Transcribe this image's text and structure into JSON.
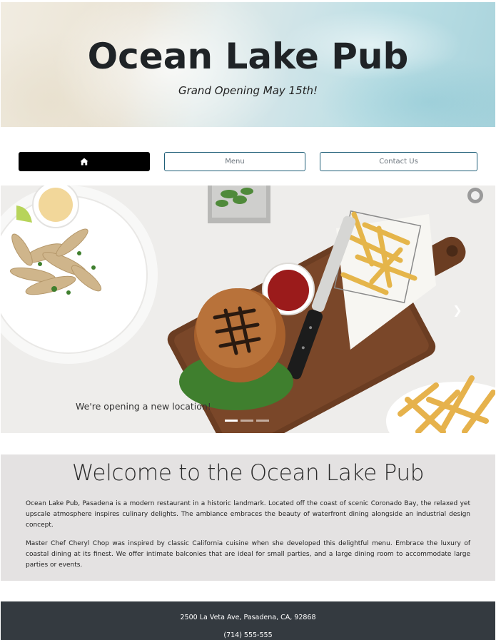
{
  "hero": {
    "title": "Ocean Lake Pub",
    "subtitle": "Grand Opening May 15th!"
  },
  "nav": {
    "home_icon": "home-icon",
    "menu_label": "Menu",
    "contact_label": "Contact Us"
  },
  "carousel": {
    "caption": "We're opening a new location!",
    "slide_count": 3,
    "active_slide": 1,
    "prev_icon": "chevron-left-icon",
    "next_icon": "chevron-right-icon"
  },
  "welcome": {
    "title": "Welcome to the Ocean Lake Pub",
    "paragraph1": "Ocean Lake Pub, Pasadena is a modern restaurant in a historic landmark. Located off the coast of scenic Coronado Bay, the relaxed yet upscale atmosphere inspires culinary delights. The ambiance embraces the beauty of waterfront dining alongside an industrial design concept.",
    "paragraph2": "Master Chef Cheryl Chop was inspired by classic California cuisine when she developed this delightful menu. Embrace the luxury of coastal dining at its finest. We offer intimate balconies that are ideal for small parties, and a large dining room to accommodate large parties or events."
  },
  "footer": {
    "address": "2500 La Veta Ave, Pasadena, CA, 92868",
    "phone": "(714) 555-555"
  },
  "colors": {
    "nav_border": "#1f5f78",
    "welcome_bg": "#e4e2e2",
    "footer_bg": "#343a40"
  }
}
